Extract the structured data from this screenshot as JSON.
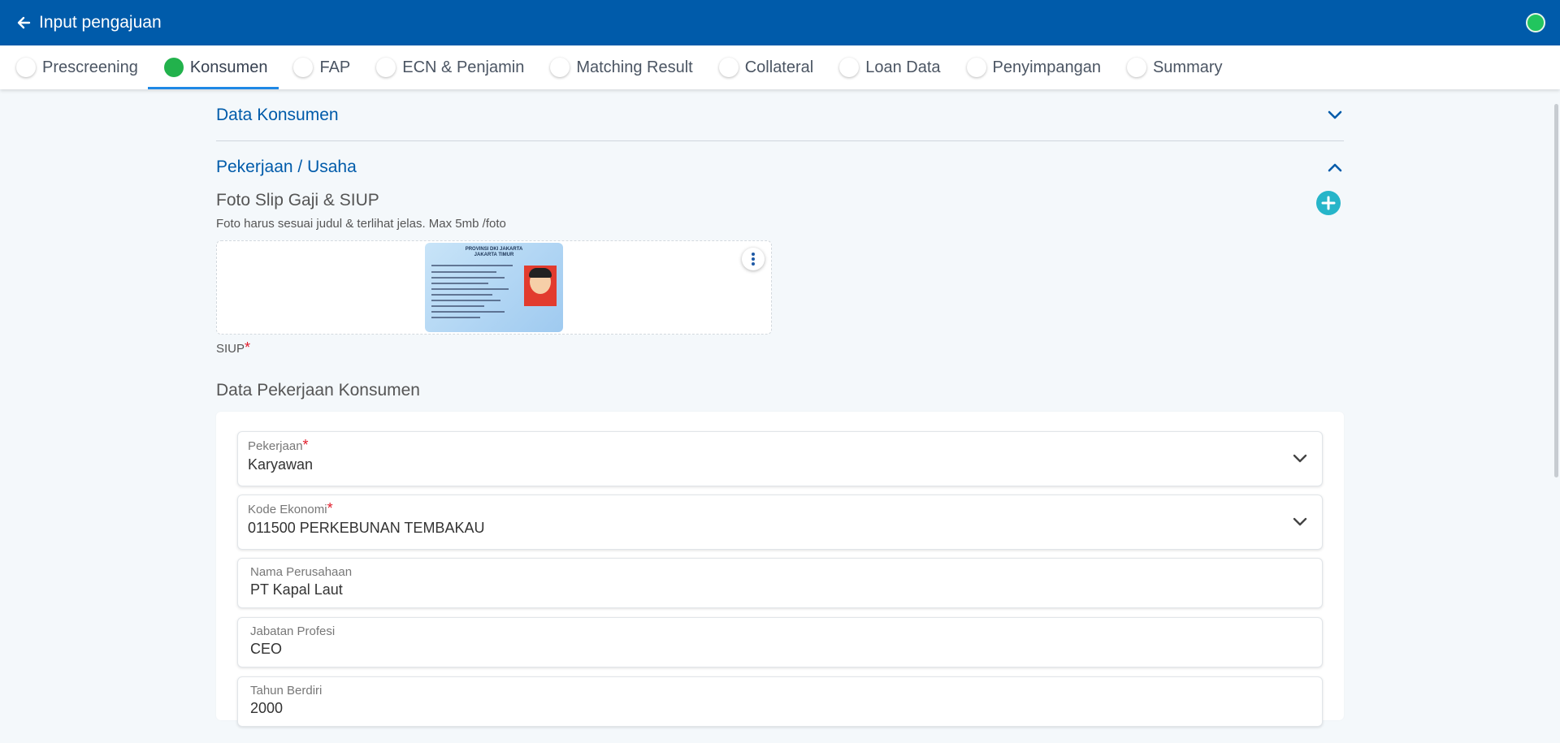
{
  "header": {
    "back_icon": "arrow-left-icon",
    "title": "Input pengajuan",
    "status_color": "#22c55e"
  },
  "tabs": [
    {
      "label": "Prescreening",
      "active": false
    },
    {
      "label": "Konsumen",
      "active": true
    },
    {
      "label": "FAP",
      "active": false
    },
    {
      "label": "ECN & Penjamin",
      "active": false
    },
    {
      "label": "Matching Result",
      "active": false
    },
    {
      "label": "Collateral",
      "active": false
    },
    {
      "label": "Loan Data",
      "active": false
    },
    {
      "label": "Penyimpangan",
      "active": false
    },
    {
      "label": "Summary",
      "active": false
    }
  ],
  "accordion": {
    "data_konsumen": {
      "title": "Data Konsumen",
      "expanded": false
    },
    "pekerjaan": {
      "title": "Pekerjaan / Usaha",
      "expanded": true
    }
  },
  "photos": {
    "title": "Foto Slip Gaji & SIUP",
    "hint": "Foto harus sesuai judul & terlihat jelas. Max 5mb /foto",
    "ktp_header_1": "PROVINSI DKI JAKARTA",
    "ktp_header_2": "JAKARTA TIMUR",
    "caption": "SIUP",
    "required_mark": "*"
  },
  "job_section": {
    "title": "Data Pekerjaan Konsumen",
    "fields": {
      "pekerjaan": {
        "label": "Pekerjaan",
        "required": "*",
        "value": "Karyawan"
      },
      "kode_ekonomi": {
        "label": "Kode Ekonomi",
        "required": "*",
        "value": "011500 PERKEBUNAN TEMBAKAU"
      },
      "nama_perusahaan": {
        "label": "Nama Perusahaan",
        "value": "PT Kapal Laut"
      },
      "jabatan": {
        "label": "Jabatan Profesi",
        "value": "CEO"
      },
      "tahun_berdiri": {
        "label": "Tahun Berdiri",
        "value": "2000"
      }
    }
  },
  "colors": {
    "primary": "#005baa",
    "active_step": "#22b24c",
    "add_button": "#26b5c9",
    "required": "#e11d2b"
  }
}
